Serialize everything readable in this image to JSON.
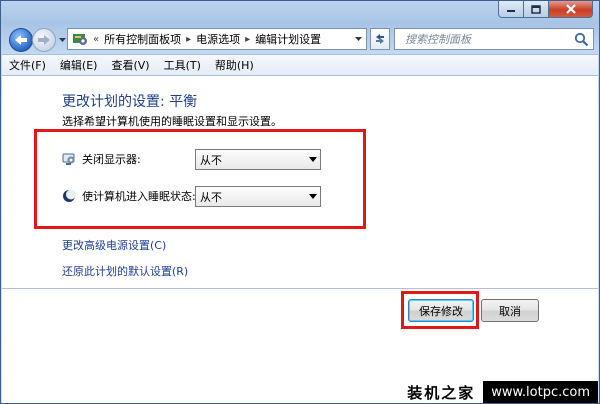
{
  "window": {
    "controls": [
      "minimize-icon",
      "maximize-icon",
      "close-icon"
    ]
  },
  "address_bar": {
    "prefix": "«",
    "breadcrumbs": [
      "所有控制面板项",
      "电源选项",
      "编辑计划设置"
    ],
    "search_placeholder": "搜索控制面板"
  },
  "menu": [
    "文件(F)",
    "编辑(E)",
    "查看(V)",
    "工具(T)",
    "帮助(H)"
  ],
  "content": {
    "heading": "更改计划的设置: 平衡",
    "subheading": "选择希望计算机使用的睡眠设置和显示设置。",
    "settings": [
      {
        "label": "关闭显示器:",
        "value": "从不",
        "icon": "monitor-icon"
      },
      {
        "label": "使计算机进入睡眠状态:",
        "value": "从不",
        "icon": "sleep-moon-icon"
      }
    ],
    "links": [
      "更改高级电源设置(C)",
      "还原此计划的默认设置(R)"
    ],
    "buttons": {
      "save": "保存修改",
      "cancel": "取消"
    }
  },
  "watermark": {
    "brand": "装机之家",
    "url": "www.lotpc.com"
  },
  "colors": {
    "highlight_box": "#e11818",
    "heading": "#1e3f8a",
    "link": "#1f3e96"
  }
}
